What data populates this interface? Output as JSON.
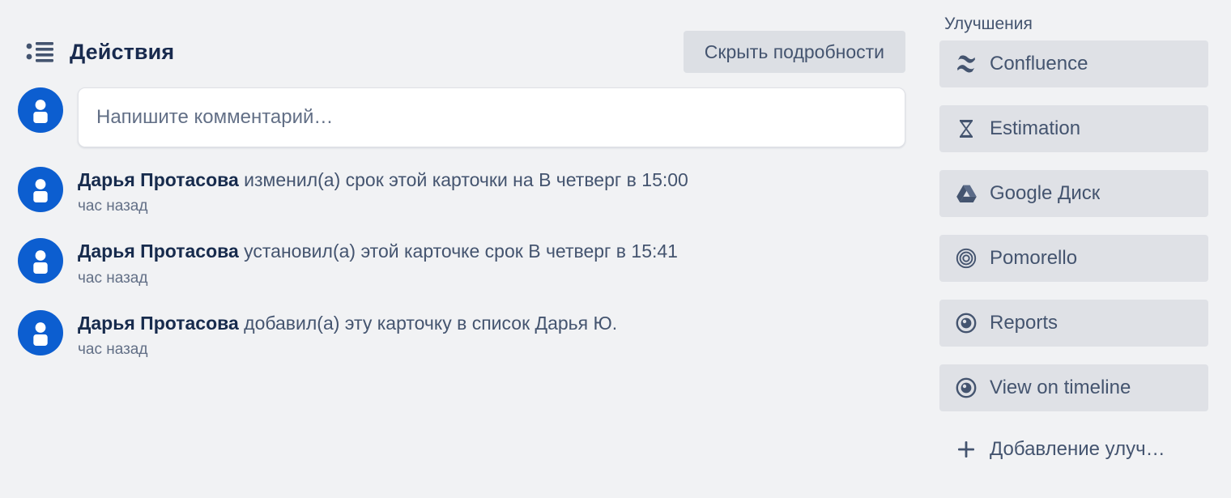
{
  "activity": {
    "icon": "list-ul-icon",
    "title": "Действия",
    "hide_details_label": "Скрыть подробности",
    "composer": {
      "avatar_icon": "user-avatar-icon",
      "placeholder": "Напишите комментарий…",
      "value": ""
    },
    "entries": [
      {
        "avatar_icon": "user-avatar-icon",
        "member": "Дарья Протасова",
        "action": " изменил(а) срок этой карточки на В четверг в 15:00",
        "time": "час назад"
      },
      {
        "avatar_icon": "user-avatar-icon",
        "member": "Дарья Протасова",
        "action": " установил(а) этой карточке срок В четверг в 15:41",
        "time": "час назад"
      },
      {
        "avatar_icon": "user-avatar-icon",
        "member": "Дарья Протасова",
        "action": " добавил(а) эту карточку в список Дарья Ю.",
        "time": "час назад"
      }
    ]
  },
  "powerups": {
    "title": "Улучшения",
    "items": [
      {
        "label": "Confluence",
        "icon": "confluence-icon"
      },
      {
        "label": "Estimation",
        "icon": "hourglass-icon"
      },
      {
        "label": "Google Диск",
        "icon": "google-drive-icon"
      },
      {
        "label": "Pomorello",
        "icon": "target-rings-icon"
      },
      {
        "label": "Reports",
        "icon": "eye-target-icon"
      },
      {
        "label": "View on timeline",
        "icon": "eye-target-icon"
      }
    ],
    "add": {
      "label": "Добавление улуч…",
      "icon": "plus-icon"
    }
  },
  "colors": {
    "page_background": "#f1f2f4",
    "panel_background": "#dfe1e6",
    "avatar_blue": "#0c5ed0",
    "text_primary": "#172b4d",
    "text_secondary": "#44546f",
    "text_muted": "#626f86",
    "composer_background": "#ffffff"
  }
}
